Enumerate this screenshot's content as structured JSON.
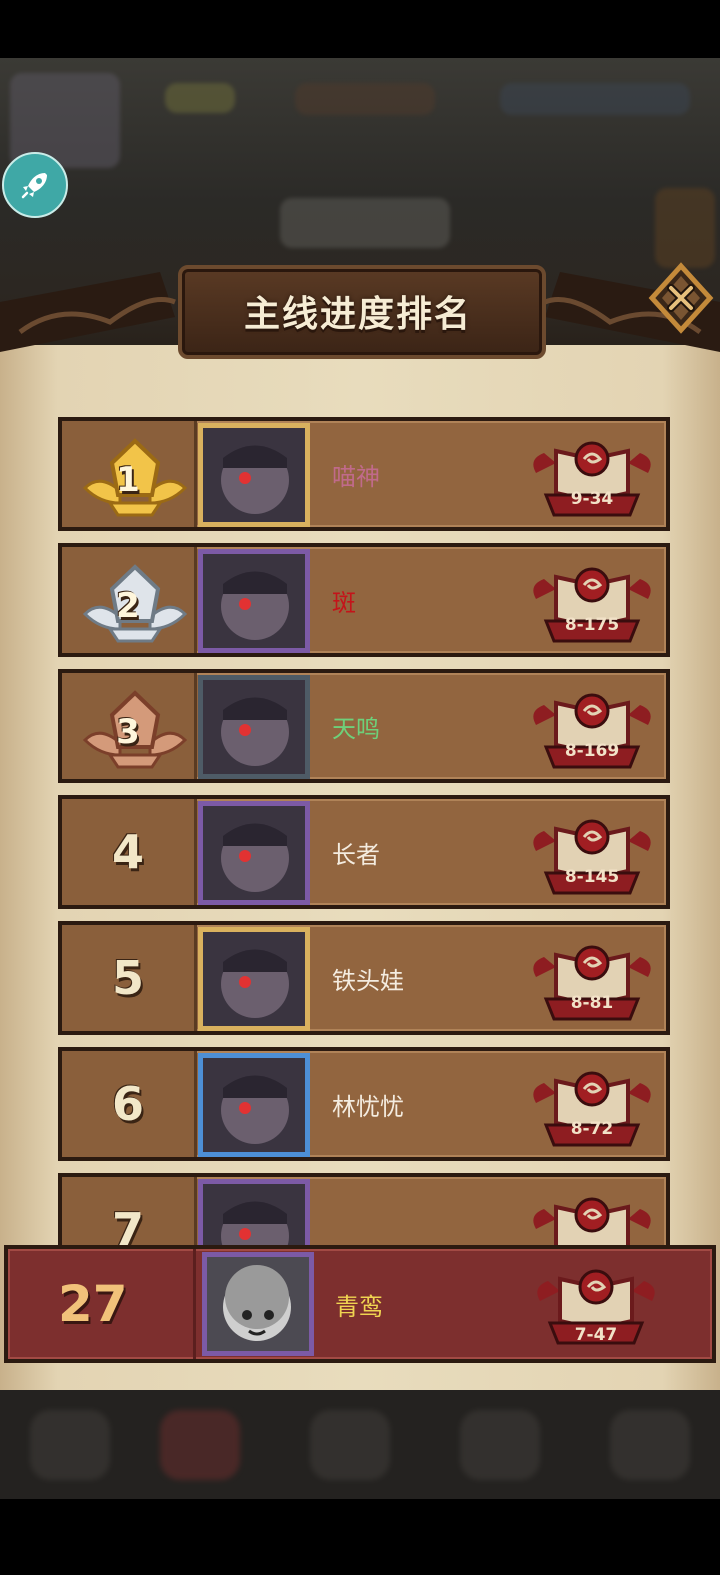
{
  "title": "主线进度排名",
  "colors": {
    "rank_gold": "#d9a636",
    "rank_silver": "#b8c2cc",
    "rank_bronze": "#b9775a",
    "row_bg": "#92653f",
    "me_bg": "#7d2f2e"
  },
  "icons": {
    "rocket": "rocket-icon",
    "close": "close-icon",
    "stage": "stage-book-icon"
  },
  "rankings": [
    {
      "rank": "1",
      "name": "喵神",
      "name_color": "#c06a8a",
      "stage": "9-34",
      "medal": "gold",
      "frame": "gold"
    },
    {
      "rank": "2",
      "name": "斑",
      "name_color": "#c4141a",
      "stage": "8-175",
      "medal": "silver",
      "frame": "purple"
    },
    {
      "rank": "3",
      "name": "天鸣",
      "name_color": "#6ed07a",
      "stage": "8-169",
      "medal": "bronze",
      "frame": "gray"
    },
    {
      "rank": "4",
      "name": "长者",
      "name_color": "#f4ece0",
      "stage": "8-145",
      "medal": "",
      "frame": "purple"
    },
    {
      "rank": "5",
      "name": "铁头娃",
      "name_color": "#f4ece0",
      "stage": "8-81",
      "medal": "",
      "frame": "gold"
    },
    {
      "rank": "6",
      "name": "林忧忧",
      "name_color": "#f4ece0",
      "stage": "8-72",
      "medal": "",
      "frame": "blue"
    },
    {
      "rank": "7",
      "name": "",
      "name_color": "#d9c84a",
      "stage": "",
      "medal": "",
      "frame": "purple"
    }
  ],
  "me": {
    "rank": "27",
    "name": "青鸾",
    "name_color": "#f0d451",
    "stage": "7-47"
  }
}
